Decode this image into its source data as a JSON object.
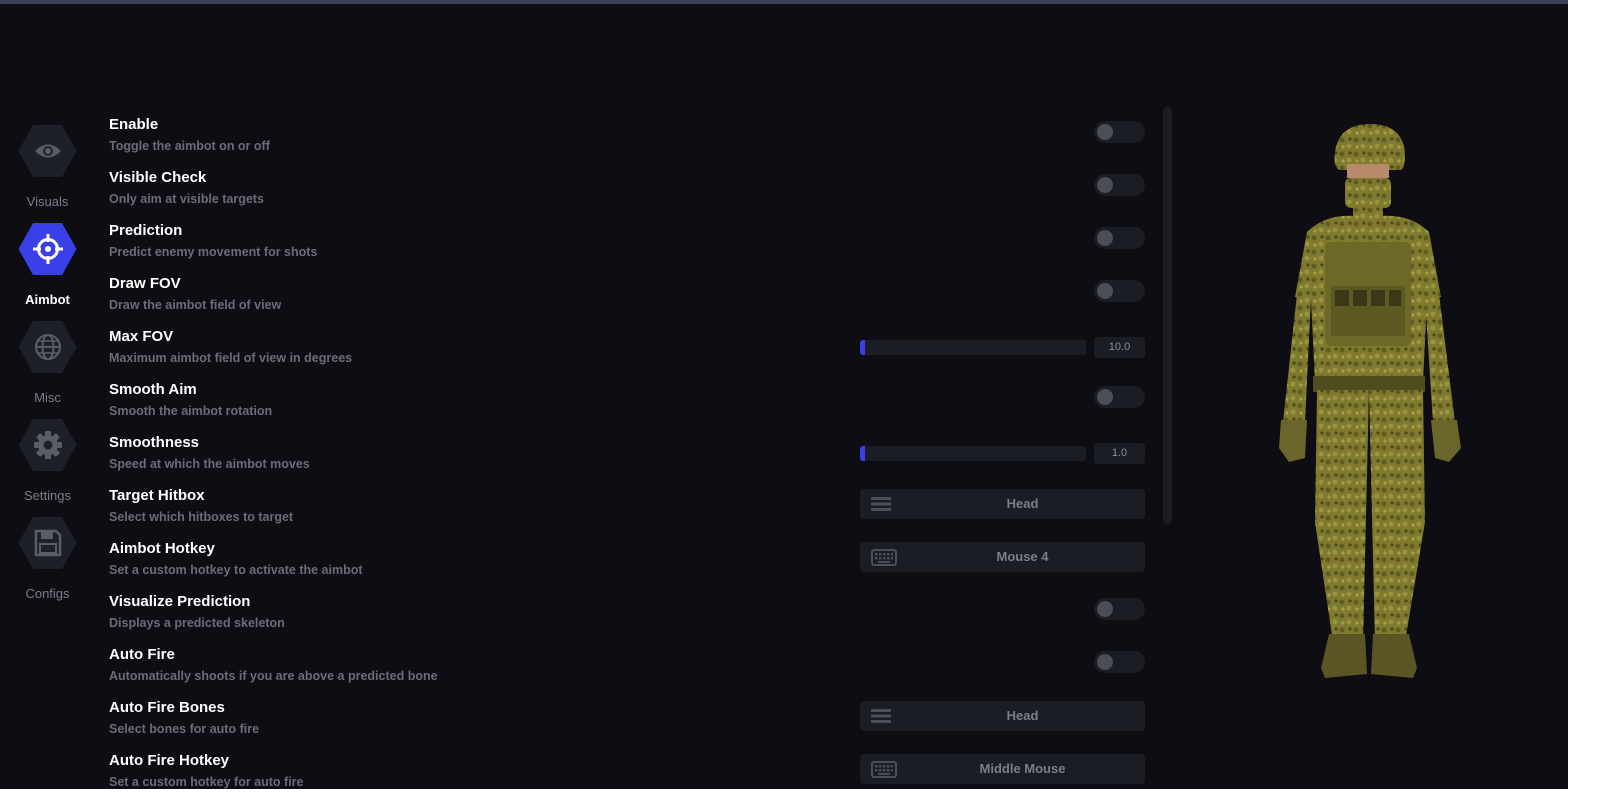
{
  "sidebar": {
    "items": [
      {
        "label": "Visuals",
        "icon": "eye-icon",
        "active": false
      },
      {
        "label": "Aimbot",
        "icon": "crosshair-icon",
        "active": true
      },
      {
        "label": "Misc",
        "icon": "globe-icon",
        "active": false
      },
      {
        "label": "Settings",
        "icon": "gear-icon",
        "active": false
      },
      {
        "label": "Configs",
        "icon": "save-icon",
        "active": false
      }
    ]
  },
  "settings": [
    {
      "title": "Enable",
      "desc": "Toggle the aimbot on or off",
      "control": "toggle",
      "on": false
    },
    {
      "title": "Visible Check",
      "desc": "Only aim at visible targets",
      "control": "toggle",
      "on": false
    },
    {
      "title": "Prediction",
      "desc": "Predict enemy movement for shots",
      "control": "toggle",
      "on": false
    },
    {
      "title": "Draw FOV",
      "desc": "Draw the aimbot field of view",
      "control": "toggle",
      "on": false
    },
    {
      "title": "Max FOV",
      "desc": "Maximum aimbot field of view in degrees",
      "control": "slider",
      "value": "10.0",
      "fill_fraction": 0.02
    },
    {
      "title": "Smooth Aim",
      "desc": "Smooth the aimbot rotation",
      "control": "toggle",
      "on": false
    },
    {
      "title": "Smoothness",
      "desc": "Speed at which the aimbot moves",
      "control": "slider",
      "value": "1.0",
      "fill_fraction": 0.02
    },
    {
      "title": "Target Hitbox",
      "desc": "Select which hitboxes to target",
      "control": "dropdown",
      "value": "Head",
      "icon": "list-icon"
    },
    {
      "title": "Aimbot Hotkey",
      "desc": "Set a custom hotkey to activate the aimbot",
      "control": "hotkey",
      "value": "Mouse 4",
      "icon": "keyboard-icon"
    },
    {
      "title": "Visualize Prediction",
      "desc": "Displays a predicted skeleton",
      "control": "toggle",
      "on": false
    },
    {
      "title": "Auto Fire",
      "desc": "Automatically shoots if you are above a predicted bone",
      "control": "toggle",
      "on": false
    },
    {
      "title": "Auto Fire Bones",
      "desc": "Select bones for auto fire",
      "control": "dropdown",
      "value": "Head",
      "icon": "list-icon"
    },
    {
      "title": "Auto Fire Hotkey",
      "desc": "Set a custom hotkey for auto fire",
      "control": "hotkey",
      "value": "Middle Mouse",
      "icon": "keyboard-icon"
    }
  ],
  "colors": {
    "accent": "#3a3fe8",
    "background": "#0d0d13",
    "control_bg": "#1b1d25"
  }
}
